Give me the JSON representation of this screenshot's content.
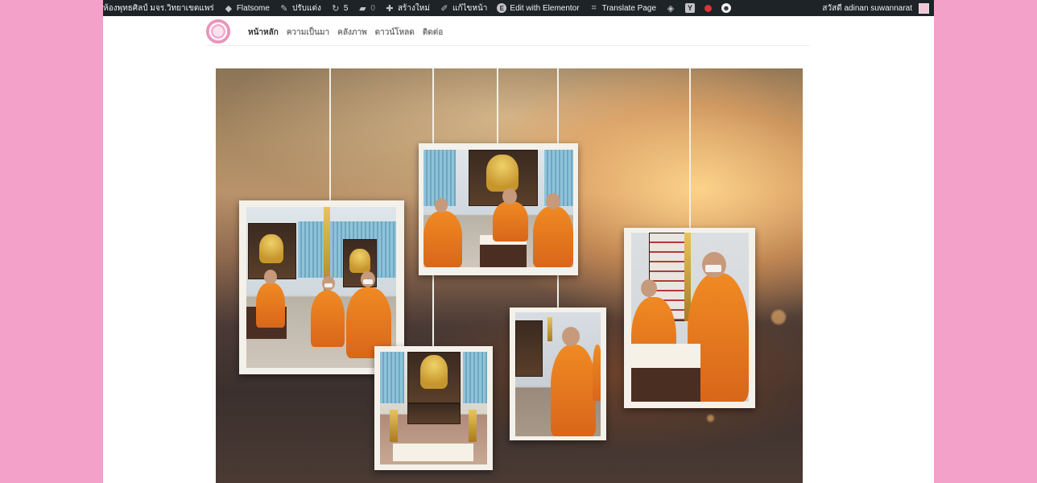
{
  "adminbar": {
    "site_name": "ห้องพุทธศิลป์ มจร.วิทยาเขตแพร่",
    "theme": "Flatsome",
    "customize": "ปรับแต่ง",
    "updates_count": "5",
    "comments_count": "0",
    "new": "สร้างใหม่",
    "edit_page": "แก้ไขหน้า",
    "edit_elementor": "Edit with Elementor",
    "translate_page": "Translate Page",
    "greeting": "สวัสดี adinan suwannarat",
    "icons": {
      "site": "wp-logo-icon",
      "theme": "flatsome-icon",
      "customize": "brush-icon",
      "updates": "refresh-icon",
      "comments": "comment-icon",
      "new": "plus-icon",
      "edit": "pencil-icon",
      "elementor": "elementor-icon",
      "translate": "translate-icon",
      "diamond": "diamond-icon",
      "yoast": "yoast-icon",
      "status": "red-dot-icon",
      "smile": "smile-icon"
    }
  },
  "nav": {
    "items": [
      "หน้าหลัก",
      "ความเป็นมา",
      "คลังภาพ",
      "ดาวน์โหลด",
      "ติดต่อ"
    ],
    "active_index": 0
  },
  "colors": {
    "page_background": "#f4a1c9",
    "adminbar": "#1d2327",
    "robe": "#f08a23",
    "status_dot": "#d63638"
  }
}
